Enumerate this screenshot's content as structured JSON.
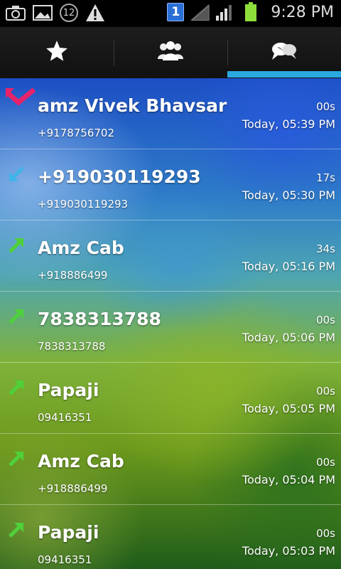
{
  "status_bar": {
    "notification_count": "12",
    "sim_label": "1",
    "time": "9:28 PM"
  },
  "tabs": [
    {
      "name": "favorites",
      "icon": "star-icon"
    },
    {
      "name": "contacts",
      "icon": "group-icon"
    },
    {
      "name": "call-log",
      "icon": "chat-bubbles-icon",
      "selected": true
    }
  ],
  "colors": {
    "tab_indicator": "#2aa9e0",
    "missed": "#e8236a",
    "incoming": "#3fb5e8",
    "outgoing": "#4fd13a"
  },
  "calls": [
    {
      "type": "missed",
      "name": "amz Vivek Bhavsar",
      "number": "+9178756702",
      "duration": "00s",
      "time": "Today, 05:39 PM"
    },
    {
      "type": "incoming",
      "name": "+919030119293",
      "number": "+919030119293",
      "duration": "17s",
      "time": "Today, 05:30 PM"
    },
    {
      "type": "outgoing",
      "name": "Amz Cab",
      "number": "+918886499",
      "duration": "34s",
      "time": "Today, 05:16 PM"
    },
    {
      "type": "outgoing",
      "name": "7838313788",
      "number": "7838313788",
      "duration": "00s",
      "time": "Today, 05:06 PM"
    },
    {
      "type": "outgoing",
      "name": "Papaji",
      "number": "09416351",
      "duration": "00s",
      "time": "Today, 05:05 PM"
    },
    {
      "type": "outgoing",
      "name": "Amz Cab",
      "number": "+918886499",
      "duration": "00s",
      "time": "Today, 05:04 PM"
    },
    {
      "type": "outgoing",
      "name": "Papaji",
      "number": "09416351",
      "duration": "00s",
      "time": "Today, 05:03 PM"
    }
  ]
}
